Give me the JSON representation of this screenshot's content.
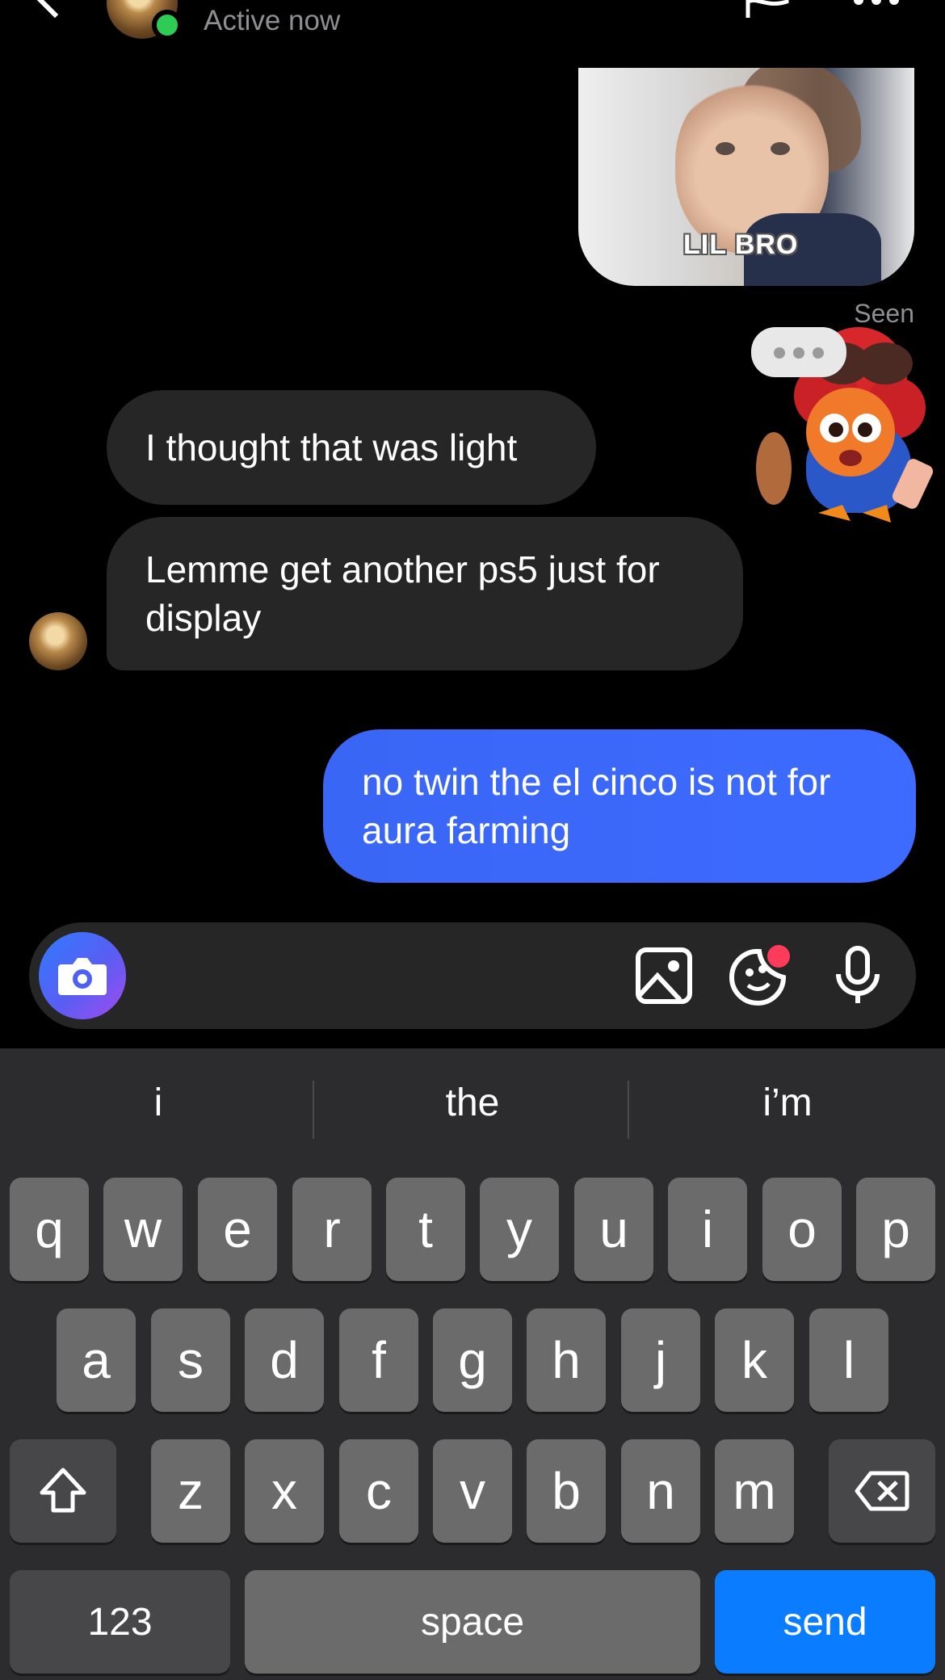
{
  "header": {
    "status": "Active now"
  },
  "thread": {
    "shared_media_caption": "LIL BRO",
    "seen_label": "Seen",
    "messages": [
      {
        "from": "them",
        "text": "I thought that was light"
      },
      {
        "from": "them",
        "text": "Lemme get another ps5 just for display"
      },
      {
        "from": "me",
        "text": "no twin the el cinco is not for aura farming"
      }
    ]
  },
  "composer": {
    "placeholder": ""
  },
  "keyboard": {
    "suggestions": [
      "i",
      "the",
      "i’m"
    ],
    "row1": [
      "q",
      "w",
      "e",
      "r",
      "t",
      "y",
      "u",
      "i",
      "o",
      "p"
    ],
    "row2": [
      "a",
      "s",
      "d",
      "f",
      "g",
      "h",
      "j",
      "k",
      "l"
    ],
    "row3": [
      "z",
      "x",
      "c",
      "v",
      "b",
      "n",
      "m"
    ],
    "numbers_label": "123",
    "space_label": "space",
    "send_label": "send"
  },
  "colors": {
    "outgoing_bubble": "#3d6bff",
    "incoming_bubble": "#262626",
    "online": "#2ecc55",
    "send_key": "#0a7cff"
  }
}
